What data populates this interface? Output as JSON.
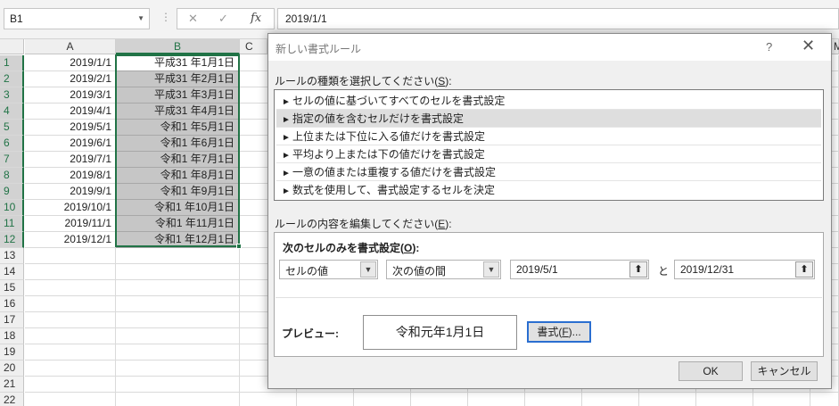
{
  "formula_bar": {
    "name_box": "B1",
    "cancel_icon": "✕",
    "enter_icon": "✓",
    "fx_label": "fx",
    "formula": "2019/1/1"
  },
  "sheet": {
    "columns": [
      "A",
      "B"
    ],
    "rows": [
      {
        "num": "1",
        "a": "2019/1/1",
        "b": "平成31 年1月1日"
      },
      {
        "num": "2",
        "a": "2019/2/1",
        "b": "平成31 年2月1日"
      },
      {
        "num": "3",
        "a": "2019/3/1",
        "b": "平成31 年3月1日"
      },
      {
        "num": "4",
        "a": "2019/4/1",
        "b": "平成31 年4月1日"
      },
      {
        "num": "5",
        "a": "2019/5/1",
        "b": "令和1 年5月1日"
      },
      {
        "num": "6",
        "a": "2019/6/1",
        "b": "令和1 年6月1日"
      },
      {
        "num": "7",
        "a": "2019/7/1",
        "b": "令和1 年7月1日"
      },
      {
        "num": "8",
        "a": "2019/8/1",
        "b": "令和1 年8月1日"
      },
      {
        "num": "9",
        "a": "2019/9/1",
        "b": "令和1 年9月1日"
      },
      {
        "num": "10",
        "a": "2019/10/1",
        "b": "令和1 年10月1日"
      },
      {
        "num": "11",
        "a": "2019/11/1",
        "b": "令和1 年11月1日"
      },
      {
        "num": "12",
        "a": "2019/12/1",
        "b": "令和1 年12月1日"
      },
      {
        "num": "13",
        "a": "",
        "b": ""
      },
      {
        "num": "14",
        "a": "",
        "b": ""
      },
      {
        "num": "15",
        "a": "",
        "b": ""
      },
      {
        "num": "16",
        "a": "",
        "b": ""
      },
      {
        "num": "17",
        "a": "",
        "b": ""
      },
      {
        "num": "18",
        "a": "",
        "b": ""
      },
      {
        "num": "19",
        "a": "",
        "b": ""
      },
      {
        "num": "20",
        "a": "",
        "b": ""
      },
      {
        "num": "21",
        "a": "",
        "b": ""
      },
      {
        "num": "22",
        "a": "",
        "b": ""
      }
    ],
    "partial_col_c": "C",
    "partial_col_m": "M"
  },
  "dialog": {
    "title": "新しい書式ルール",
    "help": "?",
    "close": "✕",
    "rule_type_label_pre": "ルールの種類を選択してください(",
    "rule_type_label_key": "S",
    "rule_type_label_post": "):",
    "rule_types": [
      "セルの値に基づいてすべてのセルを書式設定",
      "指定の値を含むセルだけを書式設定",
      "上位または下位に入る値だけを書式設定",
      "平均より上または下の値だけを書式設定",
      "一意の値または重複する値だけを書式設定",
      "数式を使用して、書式設定するセルを決定"
    ],
    "edit_label_pre": "ルールの内容を編集してください(",
    "edit_label_key": "E",
    "edit_label_post": "):",
    "format_only_pre": "次のセルのみを書式設定(",
    "format_only_key": "O",
    "format_only_post": "):",
    "condition_subject": "セルの値",
    "condition_operator": "次の値の間",
    "value_from": "2019/5/1",
    "value_to": "2019/12/31",
    "between_word": "と",
    "preview_label": "プレビュー:",
    "preview_text": "令和元年1月1日",
    "format_button_pre": "書式(",
    "format_button_key": "F",
    "format_button_post": ")...",
    "ok_button": "OK",
    "cancel_button": "キャンセル"
  }
}
